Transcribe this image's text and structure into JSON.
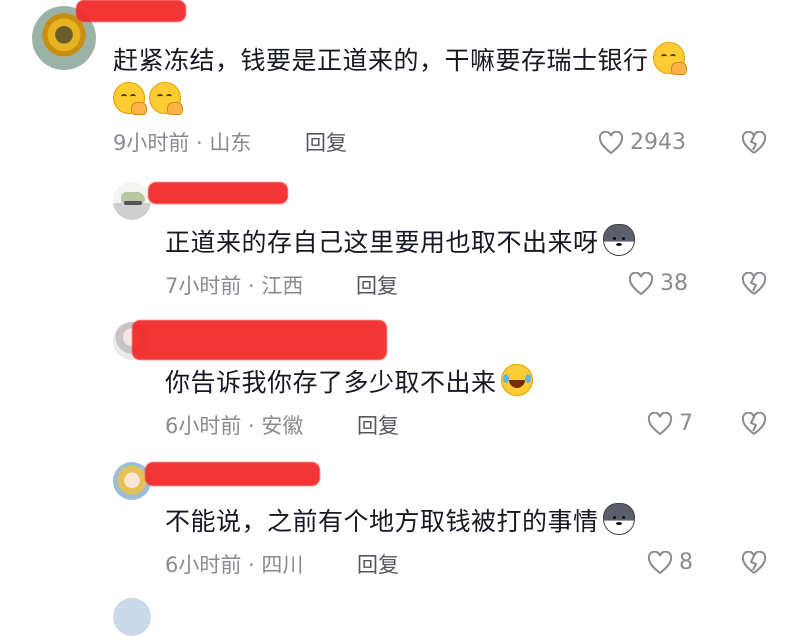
{
  "comments": [
    {
      "text": "赶紧冻结，钱要是正道来的，干嘛要存瑞士银行",
      "emojis": [
        "hehe",
        "hehe",
        "hehe"
      ],
      "time": "9小时前 · 山东",
      "reply_label": "回复",
      "likes": "2943"
    },
    {
      "text": "正道来的存自己这里要用也取不出来呀",
      "emojis": [
        "husky"
      ],
      "time": "7小时前 · 江西",
      "reply_label": "回复",
      "likes": "38"
    },
    {
      "text": "你告诉我你存了多少取不出来",
      "emojis": [
        "laugh-cry"
      ],
      "time": "6小时前 · 安徽",
      "reply_label": "回复",
      "likes": "7"
    },
    {
      "text": "不能说，之前有个地方取钱被打的事情",
      "emojis": [
        "husky"
      ],
      "time": "6小时前 · 四川",
      "reply_label": "回复",
      "likes": "8"
    }
  ],
  "icons": {
    "like": "heart-outline-icon",
    "dislike": "broken-heart-icon"
  },
  "colors": {
    "text": "#161823",
    "meta": "#8a8b91",
    "redaction": "#f22b2b"
  }
}
